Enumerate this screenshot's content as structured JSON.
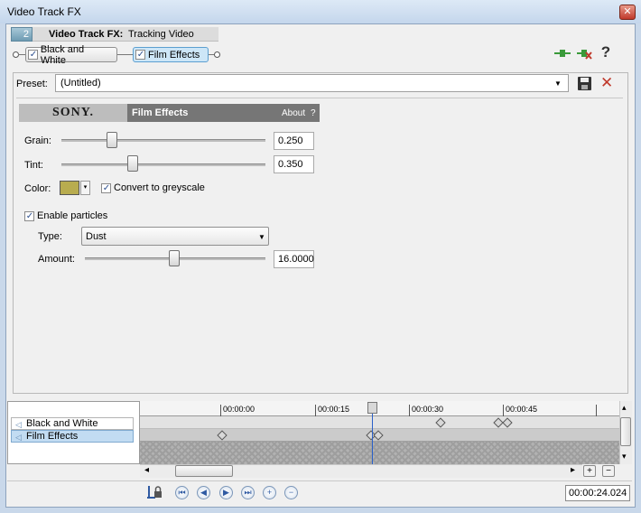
{
  "window": {
    "title": "Video Track FX",
    "close_glyph": "✕"
  },
  "header": {
    "track_number": "2",
    "label": "Video Track FX:",
    "name": "Tracking Video"
  },
  "chain": {
    "plugins": [
      {
        "label": "Black and White",
        "checked": true
      },
      {
        "label": "Film Effects",
        "checked": true,
        "active": true
      }
    ]
  },
  "toolbar": {
    "icons": [
      "plug-in-chain-icon",
      "remove-plugin-icon",
      "help-icon"
    ],
    "help_glyph": "?"
  },
  "preset": {
    "label": "Preset:",
    "value": "(Untitled)",
    "delete_glyph": "✕"
  },
  "plugin_banner": {
    "vendor": "SONY.",
    "name": "Film Effects",
    "about": "About",
    "help": "?"
  },
  "params": {
    "grain": {
      "label": "Grain:",
      "value": "0.250",
      "level": 0.25
    },
    "tint": {
      "label": "Tint:",
      "value": "0.350",
      "level": 0.35
    },
    "color": {
      "label": "Color:",
      "swatch": "#b8ac4f",
      "dropdown_glyph": "▾"
    },
    "greyscale": {
      "label": "Convert to greyscale",
      "checked": true
    },
    "particles": {
      "label": "Enable particles",
      "checked": true
    },
    "type": {
      "label": "Type:",
      "value": "Dust",
      "arrow_glyph": "▼"
    },
    "amount": {
      "label": "Amount:",
      "value": "16.0000"
    }
  },
  "keyframes": {
    "tracks": [
      {
        "label": "Black and White",
        "selected": false
      },
      {
        "label": "Film Effects",
        "selected": true
      }
    ],
    "ruler_labels": [
      "00:00:00",
      "00:00:15",
      "00:00:30",
      "00:00:45"
    ],
    "time": "00:00:24.024",
    "scroll_left": "◂",
    "scroll_right": "▸",
    "scroll_up": "▴",
    "scroll_down": "▾",
    "zoom_in": "+",
    "zoom_out": "−",
    "track_arrow": "◁",
    "nav_first": "⏮",
    "nav_prev": "◀",
    "nav_next": "▶",
    "nav_last": "⏭",
    "nav_add": "+",
    "nav_delete": "−"
  }
}
